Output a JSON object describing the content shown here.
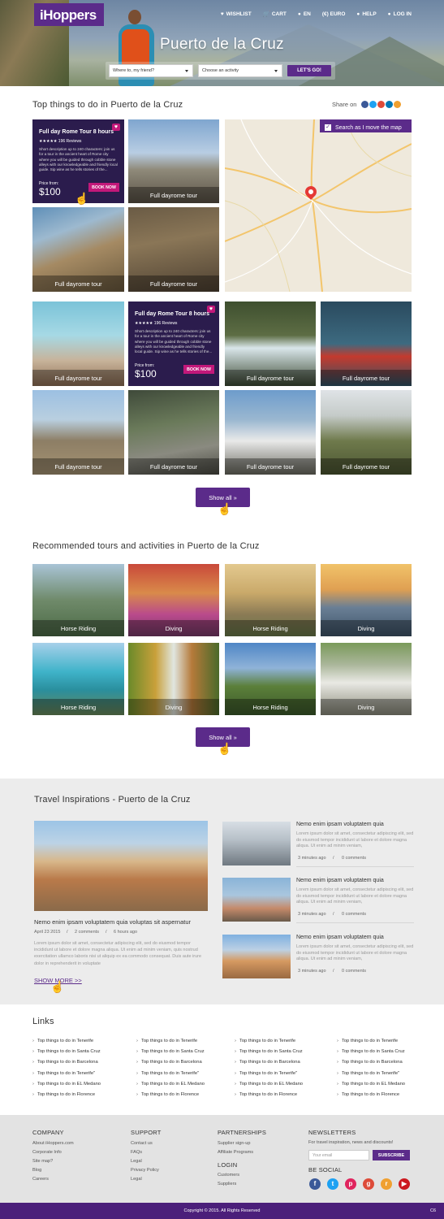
{
  "logo": "iHoppers",
  "topnav": [
    {
      "icon": "heart-icon",
      "label": "WISHLIST"
    },
    {
      "icon": "cart-icon",
      "label": "CART"
    },
    {
      "icon": "globe-icon",
      "label": "EN"
    },
    {
      "icon": "currency-icon",
      "label": "(€) EURO"
    },
    {
      "icon": "help-icon",
      "label": "HELP"
    },
    {
      "icon": "user-icon",
      "label": "LOG IN"
    }
  ],
  "hero": {
    "title": "Puerto de la Cruz",
    "search_friend": "Where to, my friend?",
    "search_activity": "Choose an activity",
    "go": "LET'S GO!"
  },
  "top": {
    "title": "Top things to do in Puerto de la Cruz",
    "share": "Share on",
    "map_toggle": "Search as I move the map",
    "promo": {
      "title": "Full day Rome Tour 8 hours",
      "reviews": "★★★★★ 196 Reviews",
      "description": "Short description up to 240 characters: join us for a tour in the ancient heart of Rome city where you will be guided through cobble stone alleys with our knowledgeable and friendly local guide. Sip wine as he tells stories of the...",
      "price_from": "Price from:",
      "price": "$100",
      "book": "BOOK NOW"
    },
    "caption": "Full dayrome tour",
    "show_all": "Show all  »"
  },
  "recommended": {
    "title": "Recommended tours and activities in Puerto de la Cruz",
    "items": [
      "Horse Riding",
      "Diving",
      "Horse Riding",
      "Diving",
      "Horse Riding",
      "Diving",
      "Horse Riding",
      "Diving"
    ],
    "show_all": "Show all  »"
  },
  "travel": {
    "title": "Travel Inspirations - Puerto de la Cruz",
    "main": {
      "title": "Nemo enim ipsam voluptatem quia voluptas sit aspernatur",
      "date": "April 23 2015",
      "comments": "2 comments",
      "ago": "6 hours ago",
      "body": "Lorem ipsum dolor sit amet, consectetur adipiscing elit, sed do eiusmod tempor incididunt ut labore et dolore magna aliqua. Ut enim ad minim veniam, quis nostrud exercitation ullamco laboris nisi ut aliquip ex ea commodo consequat. Duis aute irure dolor in reprehenderit in voluptate"
    },
    "show_more": "SHOW MORE >>",
    "side": [
      {
        "title": "Nemo enim ipsam voluptatem quia",
        "body": "Lorem ipsum dolor sit amet, consectetur adipiscing elit, sed do eiusmod tempor incididunt ut labore et dolore magna aliqua. Ut enim ad minim veniam,",
        "ago": "3 minutes ago",
        "comments": "0 comments"
      },
      {
        "title": "Nemo enim ipsam voluptatem quia",
        "body": "Lorem ipsum dolor sit amet, consectetur adipiscing elit, sed do eiusmod tempor incididunt ut labore et dolore magna aliqua. Ut enim ad minim veniam,",
        "ago": "3 minutes ago",
        "comments": "0 comments"
      },
      {
        "title": "Nemo enim ipsam voluptatem quia",
        "body": "Lorem ipsum dolor sit amet, consectetur adipiscing elit, sed do eiusmod tempor incididunt ut labore et dolore magna aliqua. Ut enim ad minim veniam,",
        "ago": "3 minutes ago",
        "comments": "0 comments"
      }
    ]
  },
  "links": {
    "title": "Links",
    "columns": [
      [
        "Top things to do in Tenerife",
        "Top things to do in Santa Cruz",
        "Top things to do in Barcelona",
        "Top things to do in Tenerife\"",
        "Top things to do in EL Medano",
        "Top things to do in Florence"
      ],
      [
        "Top things to do in Tenerife",
        "Top things to do in Santa Cruz",
        "Top things to do in Barcelona",
        "Top things to do in Tenerife\"",
        "Top things to do in EL Medano",
        "Top things to do in Florence"
      ],
      [
        "Top things to do in Tenerife",
        "Top things to do in Santa Cruz",
        "Top things to do in Barcelona",
        "Top things to do in Tenerife\"",
        "Top things to do in EL Medano",
        "Top things to do in Florence"
      ],
      [
        "Top things to do in Tenerife",
        "Top things to do in Santa Cruz",
        "Top things to do in Barcelona",
        "Top things to do in Tenerife\"",
        "Top things to do in EL Medano",
        "Top things to do in Florence"
      ]
    ]
  },
  "footer": {
    "company": {
      "title": "COMPANY",
      "items": [
        "About iHoppers.com",
        "Corporate Info",
        "Site map?",
        "Blog",
        "Careers"
      ]
    },
    "support": {
      "title": "SUPPORT",
      "items": [
        "Contact us",
        "FAQs",
        "Legal",
        "Privacy Policy",
        "Legal"
      ]
    },
    "partnerships": {
      "title": "PARTNERSHIPS",
      "items": [
        "Supplier sign-up",
        "Affiliate Programs"
      ]
    },
    "login": {
      "title": "LOGIN",
      "items": [
        "Customers",
        "Suppliers"
      ]
    },
    "newsletters": {
      "title": "NEWSLETTERS",
      "text": "For travel inspiration, news and discounts!",
      "placeholder": "Your email",
      "button": "SUBSCRIBE"
    },
    "social_title": "BE SOCIAL",
    "copyright": "Copyright © 2015. All Rights Reserved",
    "code": "C6"
  },
  "colors": {
    "brand": "#5b2b8a",
    "accent": "#c2187a"
  }
}
